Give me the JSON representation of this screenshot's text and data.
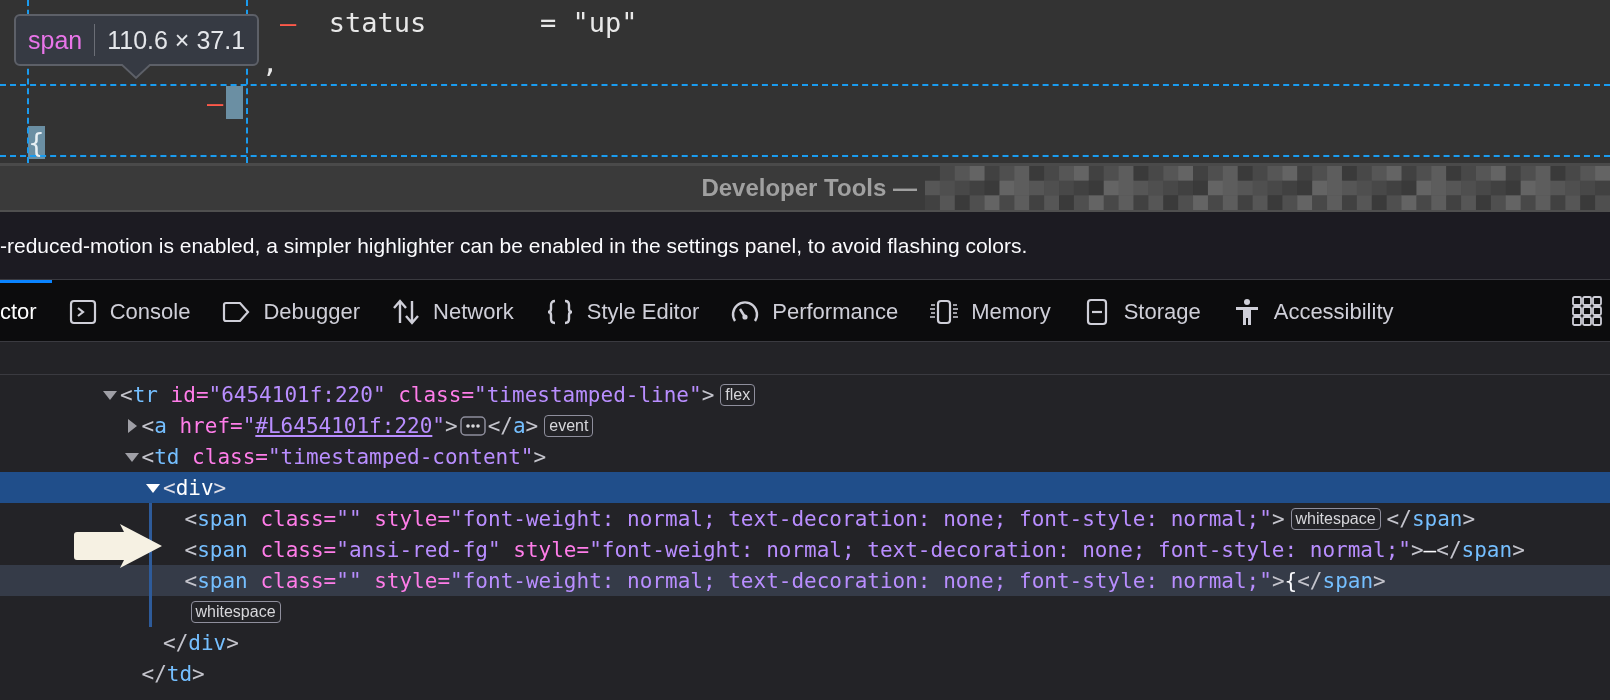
{
  "page_preview": {
    "lines": [
      {
        "segments": [
          {
            "text": "–",
            "kind": "removed"
          },
          {
            "text": "  status       = \"up\"",
            "kind": "code"
          }
        ]
      },
      {
        "segments": [
          {
            "text": ",",
            "kind": "code"
          }
        ]
      },
      {
        "segments": [
          {
            "text": "–",
            "kind": "removed"
          },
          {
            "kind": "highlight"
          }
        ]
      },
      {
        "segments": [
          {
            "text": "{",
            "kind": "highlighted"
          }
        ]
      }
    ],
    "tooltip": {
      "tag": "span",
      "size": "110.6 × 37.1"
    }
  },
  "title_bar": {
    "title": "Developer Tools —"
  },
  "notice": {
    "text": "-reduced-motion is enabled, a simpler highlighter can be enabled in the settings panel, to avoid flashing colors."
  },
  "tabs": [
    {
      "label": "ctor",
      "selected": true
    },
    {
      "label": "Console",
      "kind": "console",
      "selected": false
    },
    {
      "label": "Debugger",
      "kind": "debugger",
      "selected": false
    },
    {
      "label": "Network",
      "kind": "network",
      "selected": false
    },
    {
      "label": "Style Editor",
      "kind": "style",
      "selected": false
    },
    {
      "label": "Performance",
      "kind": "performance",
      "selected": false
    },
    {
      "label": "Memory",
      "kind": "memory",
      "selected": false
    },
    {
      "label": "Storage",
      "kind": "storage",
      "selected": false
    },
    {
      "label": "Accessibility",
      "kind": "accessibility",
      "selected": false
    }
  ],
  "markup": {
    "nodes": [
      {
        "selected": false,
        "hovered": false,
        "expanded": true,
        "segments": [
          {
            "text": "<",
            "kind": "punct"
          },
          {
            "text": "tr",
            "kind": "tag"
          },
          {
            "text": " id=",
            "kind": "attr"
          },
          {
            "text": "\"6454101f:220\"",
            "kind": "value"
          },
          {
            "text": " class=",
            "kind": "attr"
          },
          {
            "text": "\"timestamped-line\"",
            "kind": "value"
          },
          {
            "text": ">",
            "kind": "punct"
          },
          {
            "text": "flex",
            "kind": "badge"
          }
        ],
        "children": [
          {
            "selected": false,
            "hovered": false,
            "expanded": false,
            "segments": [
              {
                "text": "<",
                "kind": "punct"
              },
              {
                "text": "a",
                "kind": "tag"
              },
              {
                "text": " href=",
                "kind": "attr"
              },
              {
                "text": "\"",
                "kind": "value"
              },
              {
                "text": "#L6454101f:220",
                "kind": "link"
              },
              {
                "text": "\"",
                "kind": "value"
              },
              {
                "text": ">",
                "kind": "punct"
              },
              {
                "kind": "ellipsis"
              },
              {
                "text": "</",
                "kind": "punct"
              },
              {
                "text": "a",
                "kind": "tag"
              },
              {
                "text": ">",
                "kind": "punct"
              },
              {
                "text": "event",
                "kind": "badge"
              }
            ]
          },
          {
            "selected": false,
            "hovered": false,
            "expanded": true,
            "segments": [
              {
                "text": "<",
                "kind": "punct"
              },
              {
                "text": "td",
                "kind": "tag"
              },
              {
                "text": " class=",
                "kind": "attr"
              },
              {
                "text": "\"timestamped-content\"",
                "kind": "value"
              },
              {
                "text": ">",
                "kind": "punct"
              }
            ],
            "children": [
              {
                "selected": true,
                "hovered": false,
                "expanded": true,
                "segments": [
                  {
                    "text": "<",
                    "kind": "punct"
                  },
                  {
                    "text": "div",
                    "kind": "tag"
                  },
                  {
                    "text": ">",
                    "kind": "punct"
                  }
                ],
                "children": [
                  {
                    "selected": false,
                    "hovered": false,
                    "segments": [
                      {
                        "text": "<",
                        "kind": "punct"
                      },
                      {
                        "text": "span",
                        "kind": "tag"
                      },
                      {
                        "text": " class=",
                        "kind": "attr"
                      },
                      {
                        "text": "\"\"",
                        "kind": "value"
                      },
                      {
                        "text": " style=",
                        "kind": "attr"
                      },
                      {
                        "text": "\"font-weight: normal; text-decoration: none; font-style: normal;\"",
                        "kind": "value"
                      },
                      {
                        "text": ">",
                        "kind": "punct"
                      },
                      {
                        "text": "whitespace",
                        "kind": "badge"
                      },
                      {
                        "text": "</",
                        "kind": "punct"
                      },
                      {
                        "text": "span",
                        "kind": "tag"
                      },
                      {
                        "text": ">",
                        "kind": "punct"
                      }
                    ]
                  },
                  {
                    "selected": false,
                    "hovered": false,
                    "segments": [
                      {
                        "text": "<",
                        "kind": "punct"
                      },
                      {
                        "text": "span",
                        "kind": "tag"
                      },
                      {
                        "text": " class=",
                        "kind": "attr"
                      },
                      {
                        "text": "\"ansi-red-fg\"",
                        "kind": "value"
                      },
                      {
                        "text": " style=",
                        "kind": "attr"
                      },
                      {
                        "text": "\"font-weight: normal; text-decoration: none; font-style: normal;\"",
                        "kind": "value"
                      },
                      {
                        "text": ">",
                        "kind": "punct"
                      },
                      {
                        "text": "–",
                        "kind": "text"
                      },
                      {
                        "text": "</",
                        "kind": "punct"
                      },
                      {
                        "text": "span",
                        "kind": "tag"
                      },
                      {
                        "text": ">",
                        "kind": "punct"
                      }
                    ]
                  },
                  {
                    "selected": false,
                    "hovered": true,
                    "segments": [
                      {
                        "text": "<",
                        "kind": "punct"
                      },
                      {
                        "text": "span",
                        "kind": "tag"
                      },
                      {
                        "text": " class=",
                        "kind": "attr"
                      },
                      {
                        "text": "\"\"",
                        "kind": "value"
                      },
                      {
                        "text": " style=",
                        "kind": "attr"
                      },
                      {
                        "text": "\"font-weight: normal; text-decoration: none; font-style: normal;\"",
                        "kind": "value"
                      },
                      {
                        "text": ">",
                        "kind": "punct"
                      },
                      {
                        "text": "{",
                        "kind": "text"
                      },
                      {
                        "text": "</",
                        "kind": "punct"
                      },
                      {
                        "text": "span",
                        "kind": "tag"
                      },
                      {
                        "text": ">",
                        "kind": "punct"
                      }
                    ]
                  },
                  {
                    "selected": false,
                    "hovered": false,
                    "segments": [
                      {
                        "text": "whitespace",
                        "kind": "badge"
                      }
                    ]
                  }
                ],
                "closing": [
                  {
                    "text": "</",
                    "kind": "punct"
                  },
                  {
                    "text": "div",
                    "kind": "tag"
                  },
                  {
                    "text": ">",
                    "kind": "punct"
                  }
                ]
              }
            ],
            "closing": [
              {
                "text": "</",
                "kind": "punct"
              },
              {
                "text": "td",
                "kind": "tag"
              },
              {
                "text": ">",
                "kind": "punct"
              }
            ]
          }
        ]
      }
    ]
  }
}
